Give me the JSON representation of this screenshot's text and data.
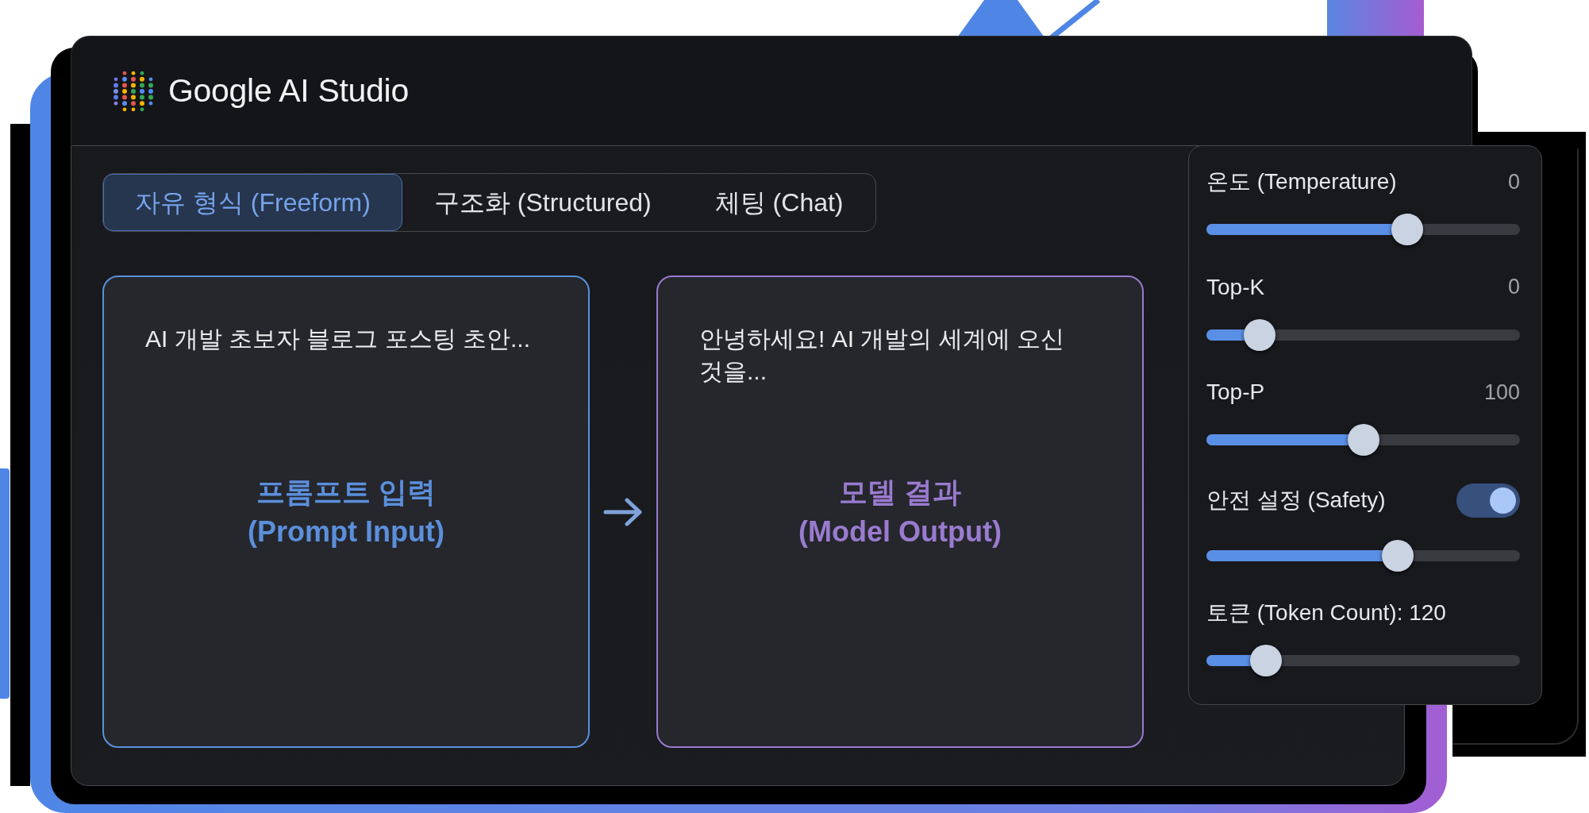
{
  "window": {
    "title": "Google AI Studio"
  },
  "tabs": [
    {
      "label": "자유 형식 (Freeform)",
      "selected": true
    },
    {
      "label": "구조화 (Structured)",
      "selected": false
    },
    {
      "label": "체팅 (Chat)",
      "selected": false
    }
  ],
  "panels": [
    {
      "text": "AI 개발 초보자 블로그 포스팅 초안...",
      "title": "프롬프트 입력",
      "subtitle": "(Prompt Input)",
      "color": "#5b8fdc"
    },
    {
      "text": "안녕하세요! AI 개발의 세계에 오신 것을...",
      "title": "모델 결과",
      "subtitle": "(Model Output)",
      "color": "#9a7bd0"
    }
  ],
  "settings": {
    "items": [
      {
        "kind": "slider",
        "label": "온도 (Temperature)",
        "value": "0",
        "level": 0.64
      },
      {
        "kind": "slider",
        "label": "Top-K",
        "value": "0",
        "level": 0.17
      },
      {
        "kind": "slider",
        "label": "Top-P",
        "value": "100",
        "level": 0.5
      },
      {
        "kind": "toggle",
        "label": "안전 설정 (Safety)",
        "on": true
      },
      {
        "kind": "slider",
        "level": 0.61
      },
      {
        "kind": "slider",
        "label": "토큰 (Token Count): 120",
        "level": 0.19
      }
    ]
  }
}
